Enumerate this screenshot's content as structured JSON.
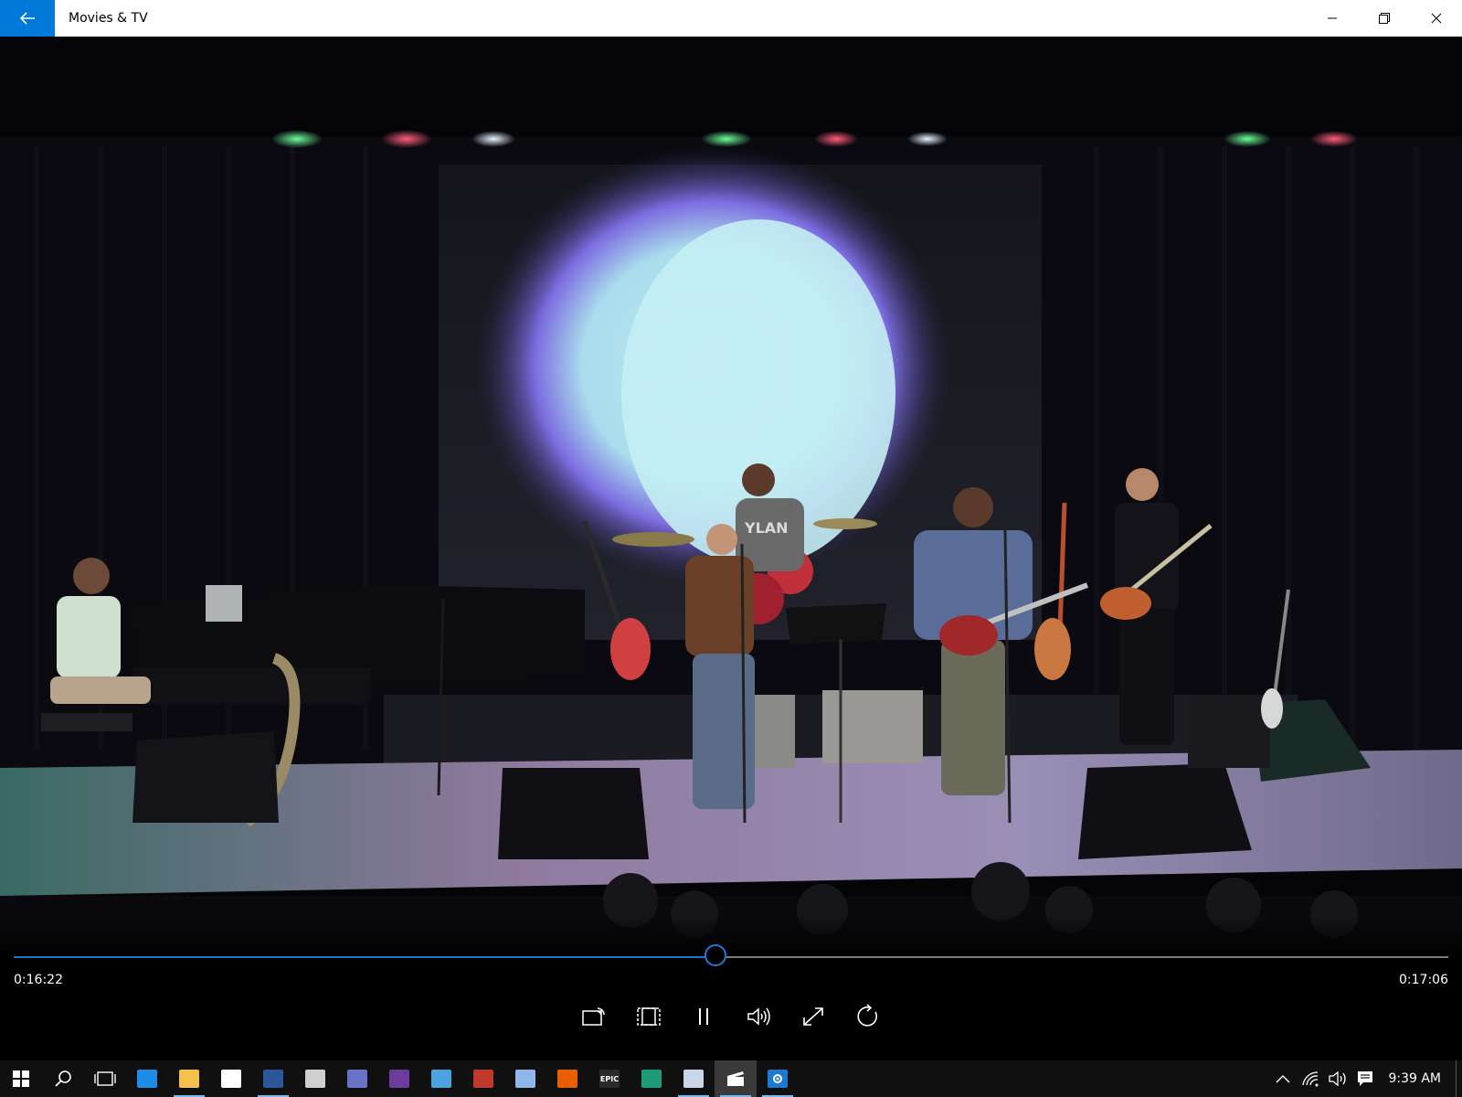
{
  "window": {
    "title": "Movies & TV"
  },
  "video": {
    "shirt_text": "YLAN"
  },
  "player": {
    "elapsed": "0:16:22",
    "total": "0:17:06",
    "progress": 0.49
  },
  "transport": [
    {
      "name": "cast-to-device-button",
      "icon": "cast-icon"
    },
    {
      "name": "aspect-ratio-button",
      "icon": "aspect-ratio-icon"
    },
    {
      "name": "pause-button",
      "icon": "pause-icon"
    },
    {
      "name": "volume-button",
      "icon": "volume-icon"
    },
    {
      "name": "full-screen-button",
      "icon": "full-screen-icon"
    },
    {
      "name": "repeat-button",
      "icon": "repeat-icon"
    }
  ],
  "taskbar": {
    "apps": [
      {
        "name": "edge",
        "icon": "edge-icon",
        "color": "#1e8be6",
        "running": false
      },
      {
        "name": "file-explorer",
        "icon": "folder-icon",
        "color": "#f2c14e",
        "running": true
      },
      {
        "name": "store",
        "icon": "store-icon",
        "color": "#ffffff",
        "running": false
      },
      {
        "name": "word",
        "icon": "word-icon",
        "color": "#2b579a",
        "running": true
      },
      {
        "name": "app-window",
        "icon": "window-app-icon",
        "color": "#cfcfcf",
        "running": false
      },
      {
        "name": "piano-app",
        "icon": "piano-icon",
        "color": "#6a72c8",
        "running": false
      },
      {
        "name": "music-app",
        "icon": "music-note-icon",
        "color": "#6c3c9c",
        "running": false
      },
      {
        "name": "photos-app",
        "icon": "photo-icon",
        "color": "#4aa3df",
        "running": false
      },
      {
        "name": "game-app",
        "icon": "game-icon",
        "color": "#c0392b",
        "running": false
      },
      {
        "name": "chat-app",
        "icon": "chat-icon",
        "color": "#8fb8e8",
        "running": false
      },
      {
        "name": "firefox",
        "icon": "firefox-icon",
        "color": "#e66000",
        "running": false
      },
      {
        "name": "epic-games",
        "icon": "epic-icon",
        "color": "#2a2a2a",
        "running": false
      },
      {
        "name": "publisher-app",
        "icon": "document-icon",
        "color": "#1f9b7a",
        "running": false
      },
      {
        "name": "paint-app",
        "icon": "paint-icon",
        "color": "#c9d6ea",
        "running": true
      },
      {
        "name": "movies-tv",
        "icon": "clapperboard-icon",
        "color": "#ffffff",
        "running": true,
        "active": true
      },
      {
        "name": "settings",
        "icon": "gear-icon",
        "color": "#1e78d2",
        "running": true
      }
    ],
    "epic_label": "EPIC",
    "time": "9:39 AM"
  }
}
